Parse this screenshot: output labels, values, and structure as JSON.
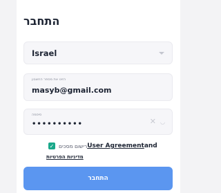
{
  "login": {
    "title": "התחבר",
    "country": {
      "value": "Israel"
    },
    "account": {
      "label": "הזינו את מספר החשבון",
      "value": "masyb@gmail.com"
    },
    "password": {
      "label": "סיסמה",
      "value": "••••••••••"
    },
    "agreement": {
      "checked": true,
      "text": "רישום מסכים",
      "user_agreement_link": "User Agreement",
      "and": "and",
      "privacy_link": "מדיניות הפרטיות"
    },
    "submit_label": "התחבר"
  },
  "colors": {
    "accent": "#5b96f0",
    "checkbox": "#1aa88a",
    "field_bg": "#f6f6f9"
  }
}
